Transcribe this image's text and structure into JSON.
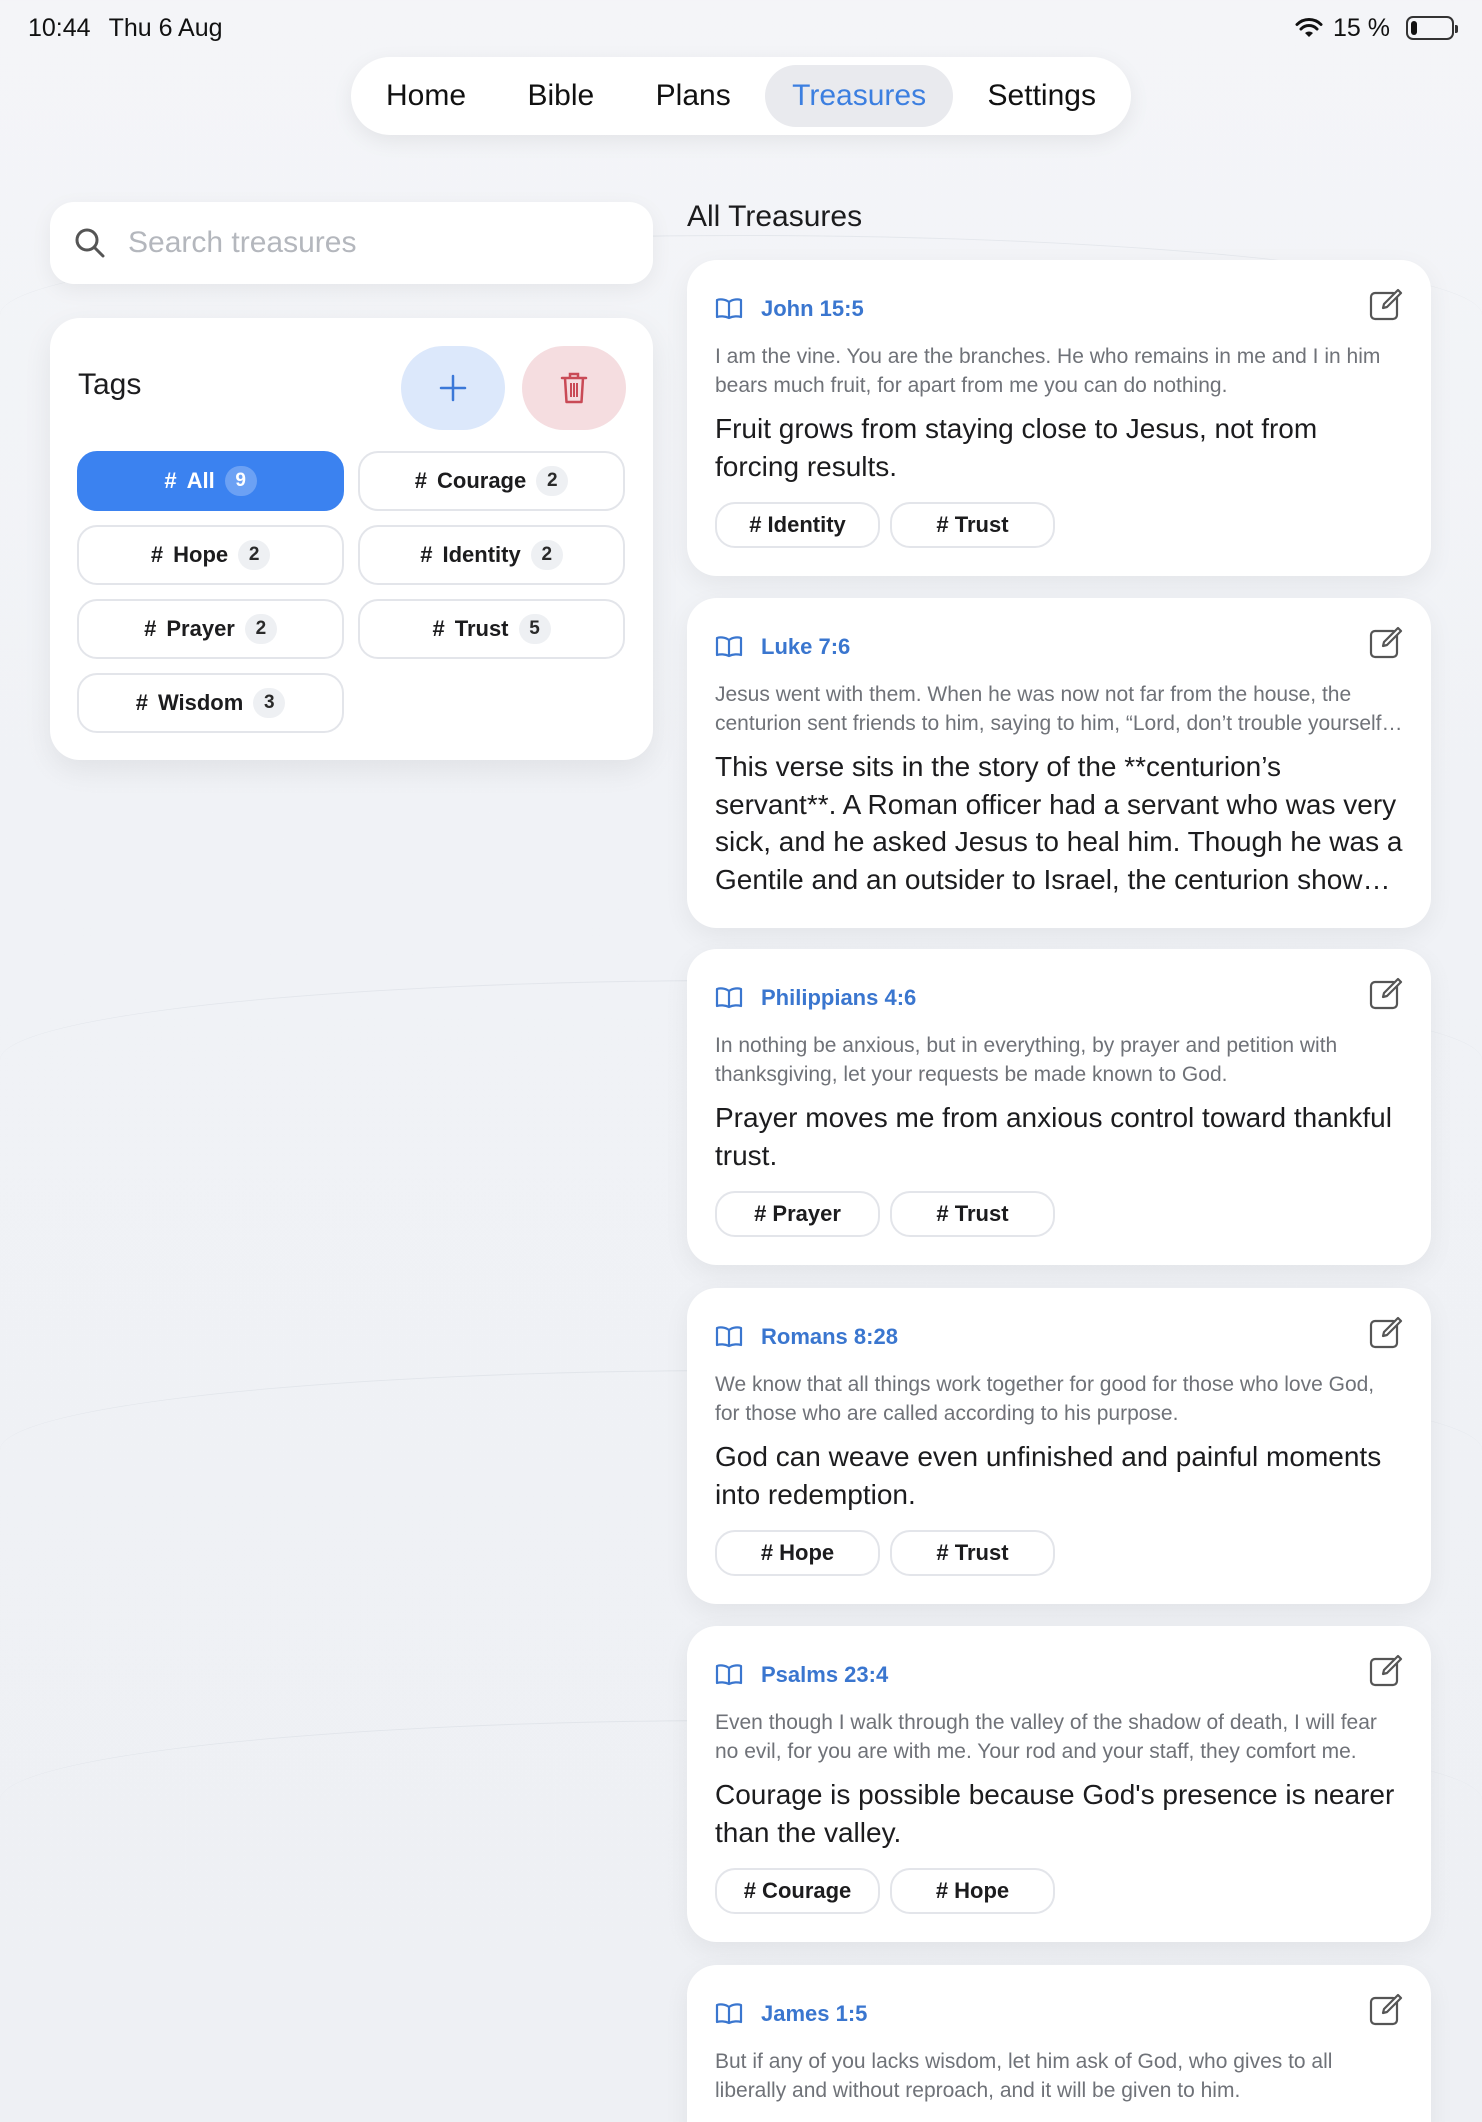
{
  "status_bar": {
    "time": "10:44",
    "date": "Thu 6 Aug",
    "battery": "15 %",
    "battery_level": 0.15
  },
  "nav": {
    "tabs": [
      {
        "label": "Home"
      },
      {
        "label": "Bible"
      },
      {
        "label": "Plans"
      },
      {
        "label": "Treasures",
        "active": true
      },
      {
        "label": "Settings"
      }
    ]
  },
  "search": {
    "placeholder": "Search treasures",
    "value": ""
  },
  "tags_panel": {
    "title": "Tags",
    "add_icon": "plus-icon",
    "delete_icon": "trash-icon",
    "hash": "#",
    "tags": [
      {
        "name": "All",
        "count": "9",
        "active": true
      },
      {
        "name": "Courage",
        "count": "2"
      },
      {
        "name": "Hope",
        "count": "2"
      },
      {
        "name": "Identity",
        "count": "2"
      },
      {
        "name": "Prayer",
        "count": "2"
      },
      {
        "name": "Trust",
        "count": "5"
      },
      {
        "name": "Wisdom",
        "count": "3"
      }
    ]
  },
  "main": {
    "title": "All Treasures",
    "cards": [
      {
        "reference": "John 15:5",
        "verse": "I am the vine. You are the branches. He who remains in me and I in him bears much fruit, for apart from me you can do nothing.",
        "note": "Fruit grows from staying close to Jesus, not from forcing results.",
        "tags": [
          "# Identity",
          "# Trust"
        ]
      },
      {
        "reference": "Luke 7:6",
        "verse": "Jesus went with them. When he was now not far from the house, the centurion sent friends to him, saying to him, “Lord, don’t trouble yourself, for I am not worthy for you to come under my roof.”",
        "note": "This verse sits in the story of the **centurion’s servant**. A Roman officer had a servant who was very sick, and he asked Jesus to heal him. Though he was a Gentile and an outsider to Israel, the centurion showed remarkable humility and faith.",
        "tags": []
      },
      {
        "reference": "Philippians 4:6",
        "verse": "In nothing be anxious, but in everything, by prayer and petition with thanksgiving, let your requests be made known to God.",
        "note": "Prayer moves me from anxious control toward thankful trust.",
        "tags": [
          "# Prayer",
          "# Trust"
        ]
      },
      {
        "reference": "Romans 8:28",
        "verse": "We know that all things work together for good for those who love God, for those who are called according to his purpose.",
        "note": "God can weave even unfinished and painful moments into redemption.",
        "tags": [
          "# Hope",
          "# Trust"
        ]
      },
      {
        "reference": "Psalms 23:4",
        "verse": "Even though I walk through the valley of the shadow of death, I will fear no evil, for you are with me. Your rod and your staff, they comfort me.",
        "note": "Courage is possible because God's presence is nearer than the valley.",
        "tags": [
          "# Courage",
          "# Hope"
        ]
      },
      {
        "reference": "James 1:5",
        "verse": "But if any of you lacks wisdom, let him ask of God, who gives to all liberally and without reproach, and it will be given to him.",
        "note": "",
        "tags": []
      }
    ]
  }
}
